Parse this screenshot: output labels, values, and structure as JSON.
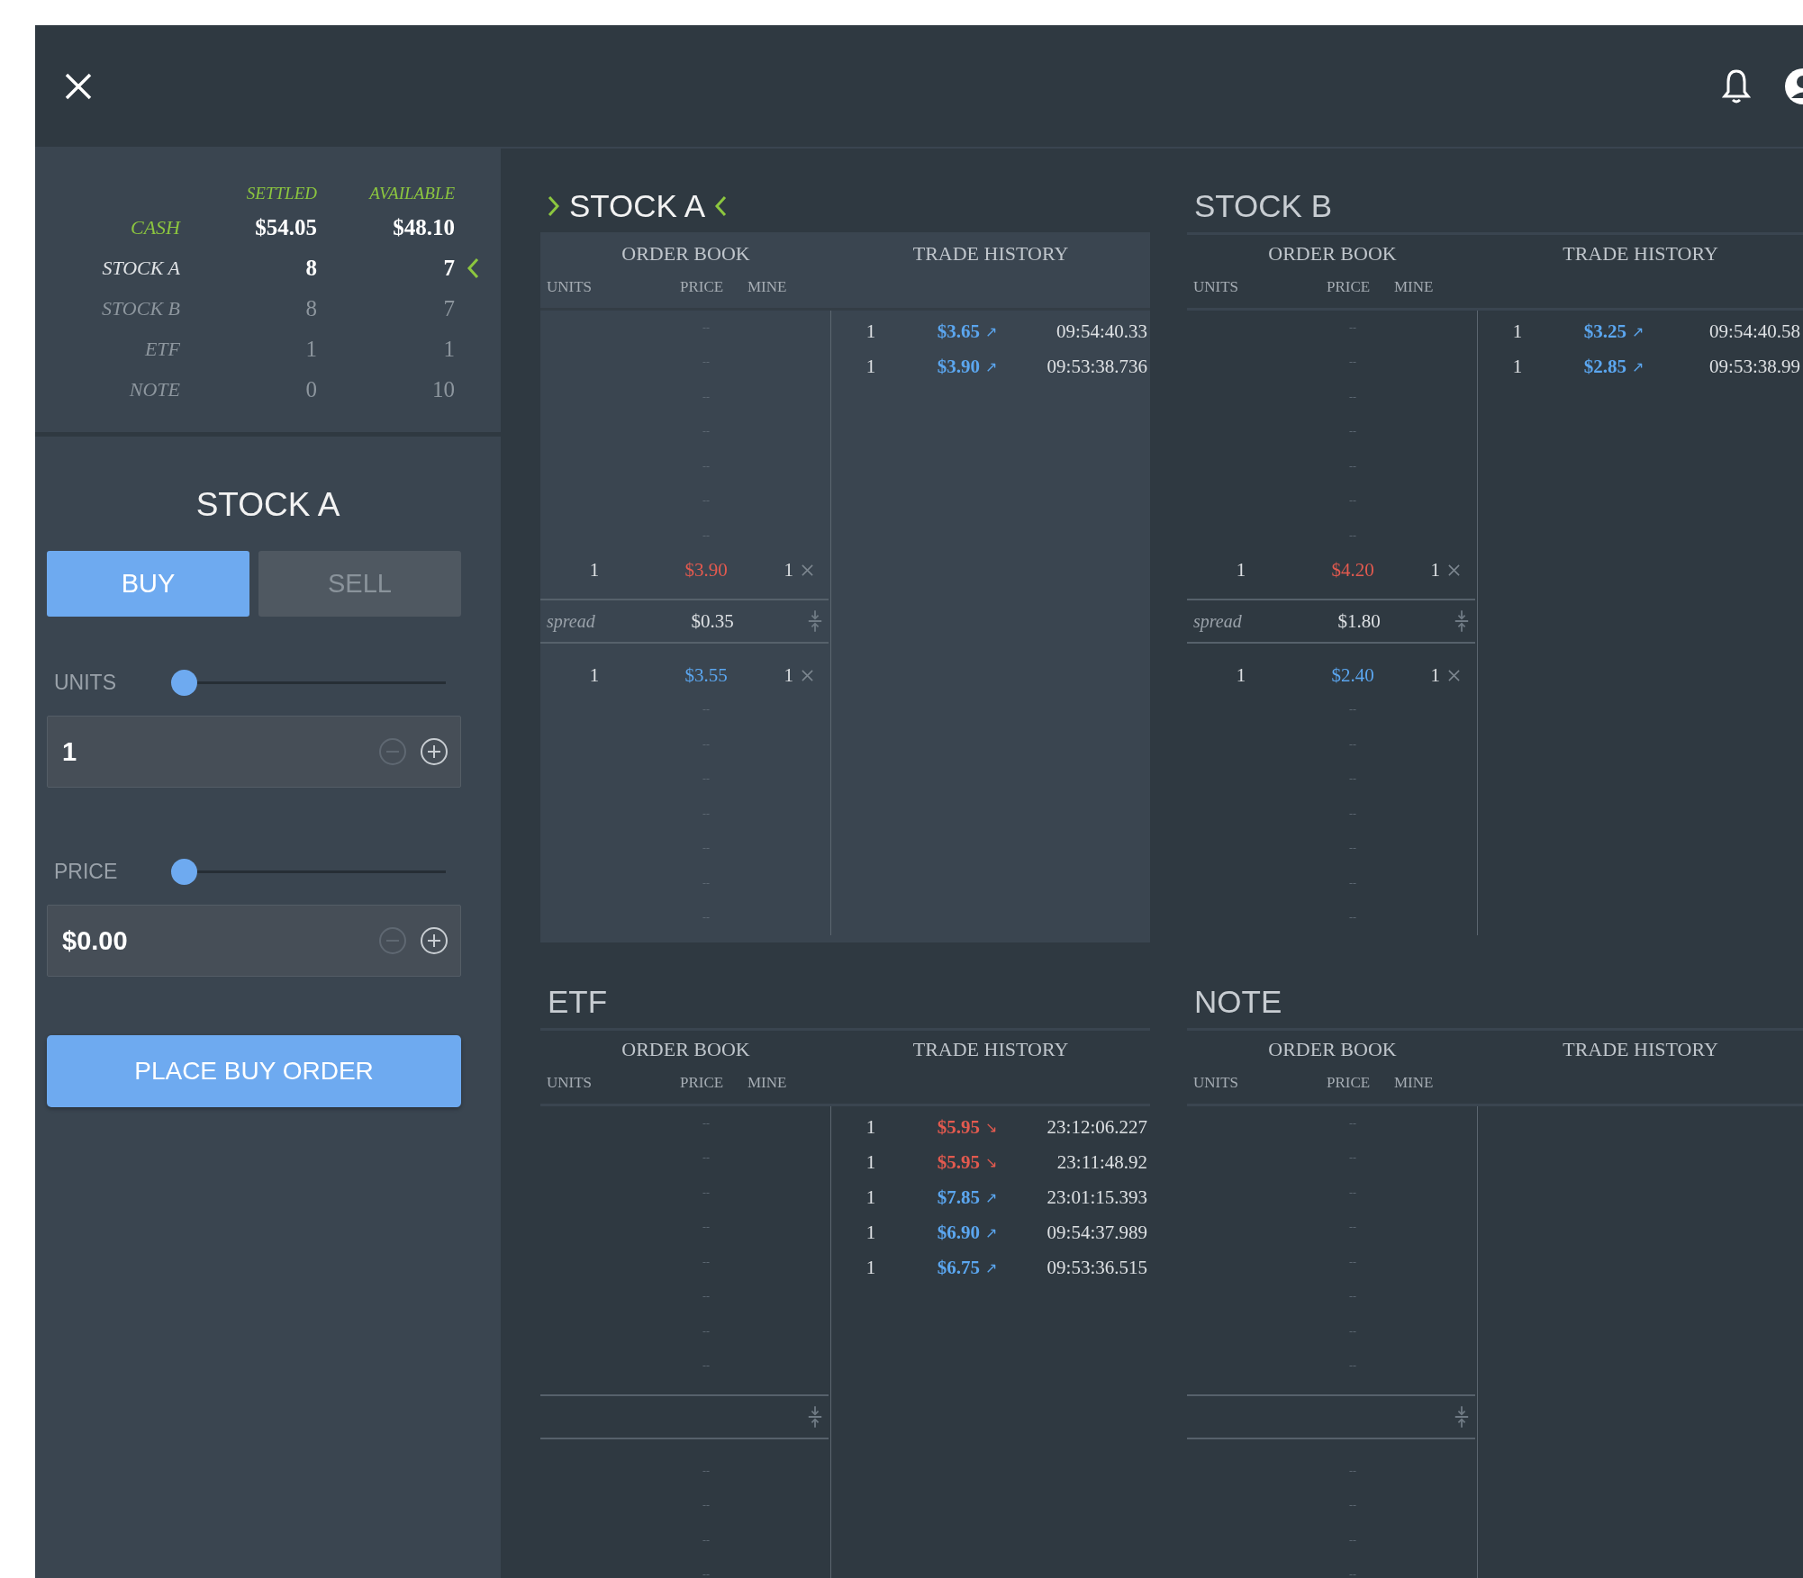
{
  "holdings": {
    "columns": [
      "SETTLED",
      "AVAILABLE"
    ],
    "rows": [
      {
        "label": "CASH",
        "kind": "cash",
        "settled": "$54.05",
        "available": "$48.10",
        "selected": false
      },
      {
        "label": "STOCK A",
        "kind": "asset",
        "settled": "8",
        "available": "7",
        "selected": true
      },
      {
        "label": "STOCK B",
        "kind": "asset",
        "settled": "8",
        "available": "7",
        "selected": false
      },
      {
        "label": "ETF",
        "kind": "asset",
        "settled": "1",
        "available": "1",
        "selected": false
      },
      {
        "label": "NOTE",
        "kind": "asset",
        "settled": "0",
        "available": "10",
        "selected": false
      }
    ]
  },
  "order_ticket": {
    "title": "STOCK A",
    "sides": [
      {
        "label": "BUY",
        "selected": true
      },
      {
        "label": "SELL",
        "selected": false
      }
    ],
    "inputs": [
      {
        "label": "UNITS",
        "level": 0,
        "value": "1",
        "minus_disabled": true
      },
      {
        "label": "PRICE",
        "level": 0,
        "value": "$0.00",
        "minus_disabled": true
      }
    ],
    "submit": "PLACE BUY ORDER"
  },
  "markets": [
    {
      "name": "STOCK A",
      "selected": true,
      "order_book": {
        "title": "ORDER BOOK",
        "columns": [
          "UNITS",
          "PRICE",
          "MINE"
        ],
        "asks": [
          {
            "price": "--"
          },
          {
            "price": "--"
          },
          {
            "price": "--"
          },
          {
            "price": "--"
          },
          {
            "price": "--"
          },
          {
            "price": "--"
          },
          {
            "price": "--"
          },
          {
            "units": "1",
            "price": "$3.90",
            "mine": "1"
          }
        ],
        "spread": {
          "label": "spread",
          "value": "$0.35"
        },
        "bids": [
          {
            "units": "1",
            "price": "$3.55",
            "mine": "1"
          },
          {
            "price": "--"
          },
          {
            "price": "--"
          },
          {
            "price": "--"
          },
          {
            "price": "--"
          },
          {
            "price": "--"
          },
          {
            "price": "--"
          },
          {
            "price": "--"
          }
        ]
      },
      "trade_history": {
        "title": "TRADE HISTORY",
        "trades": [
          {
            "units": "1",
            "price": "$3.65",
            "arrow": "↗",
            "color": "#5ba6ef",
            "time": "09:54:40.33"
          },
          {
            "units": "1",
            "price": "$3.90",
            "arrow": "↗",
            "color": "#5ba6ef",
            "time": "09:53:38.736"
          }
        ]
      }
    },
    {
      "name": "STOCK B",
      "selected": false,
      "order_book": {
        "title": "ORDER BOOK",
        "columns": [
          "UNITS",
          "PRICE",
          "MINE"
        ],
        "asks": [
          {
            "price": "--"
          },
          {
            "price": "--"
          },
          {
            "price": "--"
          },
          {
            "price": "--"
          },
          {
            "price": "--"
          },
          {
            "price": "--"
          },
          {
            "price": "--"
          },
          {
            "units": "1",
            "price": "$4.20",
            "mine": "1"
          }
        ],
        "spread": {
          "label": "spread",
          "value": "$1.80"
        },
        "bids": [
          {
            "units": "1",
            "price": "$2.40",
            "mine": "1"
          },
          {
            "price": "--"
          },
          {
            "price": "--"
          },
          {
            "price": "--"
          },
          {
            "price": "--"
          },
          {
            "price": "--"
          },
          {
            "price": "--"
          },
          {
            "price": "--"
          }
        ]
      },
      "trade_history": {
        "title": "TRADE HISTORY",
        "trades": [
          {
            "units": "1",
            "price": "$3.25",
            "arrow": "↗",
            "color": "#5ba6ef",
            "time": "09:54:40.58"
          },
          {
            "units": "1",
            "price": "$2.85",
            "arrow": "↗",
            "color": "#5ba6ef",
            "time": "09:53:38.99"
          }
        ]
      }
    },
    {
      "name": "ETF",
      "selected": false,
      "order_book": {
        "title": "ORDER BOOK",
        "columns": [
          "UNITS",
          "PRICE",
          "MINE"
        ],
        "asks": [
          {
            "price": "--"
          },
          {
            "price": "--"
          },
          {
            "price": "--"
          },
          {
            "price": "--"
          },
          {
            "price": "--"
          },
          {
            "price": "--"
          },
          {
            "price": "--"
          },
          {
            "price": "--"
          }
        ],
        "bids": [
          {
            "price": "--"
          },
          {
            "price": "--"
          },
          {
            "price": "--"
          },
          {
            "price": "--"
          }
        ]
      },
      "trade_history": {
        "title": "TRADE HISTORY",
        "trades": [
          {
            "units": "1",
            "price": "$5.95",
            "arrow": "↘",
            "color": "#e35a4f",
            "time": "23:12:06.227"
          },
          {
            "units": "1",
            "price": "$5.95",
            "arrow": "↘",
            "color": "#e35a4f",
            "time": "23:11:48.92"
          },
          {
            "units": "1",
            "price": "$7.85",
            "arrow": "↗",
            "color": "#5ba6ef",
            "time": "23:01:15.393"
          },
          {
            "units": "1",
            "price": "$6.90",
            "arrow": "↗",
            "color": "#5ba6ef",
            "time": "09:54:37.989"
          },
          {
            "units": "1",
            "price": "$6.75",
            "arrow": "↗",
            "color": "#5ba6ef",
            "time": "09:53:36.515"
          }
        ]
      }
    },
    {
      "name": "NOTE",
      "selected": false,
      "order_book": {
        "title": "ORDER BOOK",
        "columns": [
          "UNITS",
          "PRICE",
          "MINE"
        ],
        "asks": [
          {
            "price": "--"
          },
          {
            "price": "--"
          },
          {
            "price": "--"
          },
          {
            "price": "--"
          },
          {
            "price": "--"
          },
          {
            "price": "--"
          },
          {
            "price": "--"
          },
          {
            "price": "--"
          }
        ],
        "bids": [
          {
            "price": "--"
          },
          {
            "price": "--"
          },
          {
            "price": "--"
          },
          {
            "price": "--"
          }
        ]
      },
      "trade_history": {
        "title": "TRADE HISTORY"
      }
    }
  ]
}
